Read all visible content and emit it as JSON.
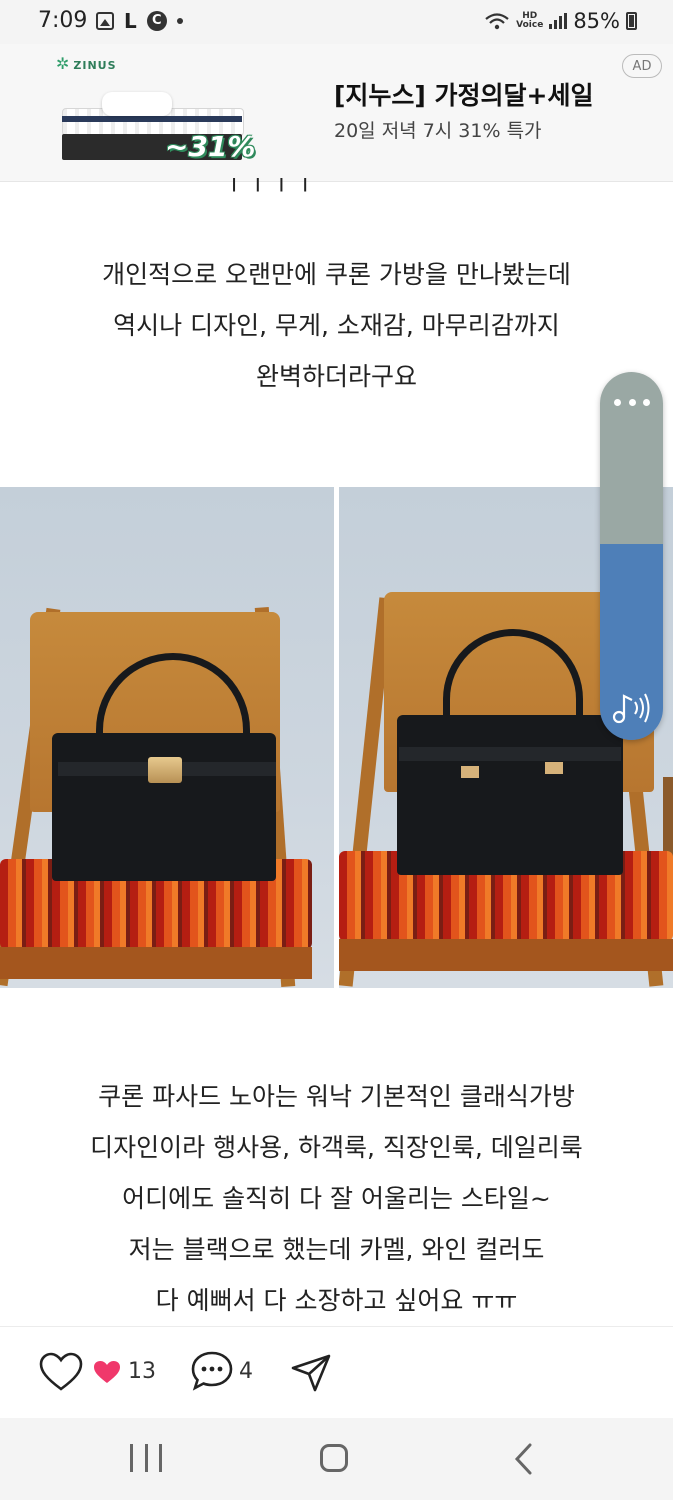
{
  "status_bar": {
    "time": "7:09",
    "left_icons": [
      "gallery-icon",
      "l-app-icon",
      "c-app-icon",
      "dot-icon"
    ],
    "l_label": "L",
    "c_label": "C",
    "hd_line1": "HD",
    "hd_line2": "Voice",
    "right_icons": [
      "wifi-icon",
      "hd-voice-icon",
      "signal-icon",
      "battery-icon"
    ],
    "battery": "85%"
  },
  "ad": {
    "brand": "ZINUS",
    "discount": "~31%",
    "title": "[지누스] 가정의달+세일",
    "subtitle": "20일 저녁 7시 31% 특가",
    "badge": "AD"
  },
  "article": {
    "paragraph1": [
      "개인적으로 오랜만에 쿠론 가방을 만나봤는데",
      "역시나 디자인, 무게, 소재감, 마무리감까지",
      "완벽하더라구요"
    ],
    "photos": [
      "bag-photo-front",
      "bag-photo-back"
    ],
    "paragraph2": [
      "쿠론 파사드 노아는 워낙 기본적인 클래식가방",
      "디자인이라 행사용, 하객룩, 직장인룩, 데일리룩",
      "어디에도 솔직히 다 잘 어울리는 스타일~",
      "저는 블랙으로 했는데 카멜, 와인 컬러도",
      "다 예뻐서 다 소장하고 싶어요 ㅠㅠ"
    ]
  },
  "audio_widget": {
    "more_icon": "more-dots-icon",
    "sound_icon": "music-note-sound-icon",
    "colors": {
      "top": "#9aa8a4",
      "bottom": "#4e7fb8"
    }
  },
  "actions": {
    "like_icon": "heart-outline-icon",
    "like_mark_icon": "heart-filled-icon",
    "like_count": "13",
    "comment_icon": "comment-bubble-icon",
    "comment_count": "4",
    "share_icon": "send-icon",
    "heart_color": "#f0386b"
  },
  "nav": {
    "items": [
      "recents-icon",
      "home-icon",
      "back-icon"
    ]
  }
}
